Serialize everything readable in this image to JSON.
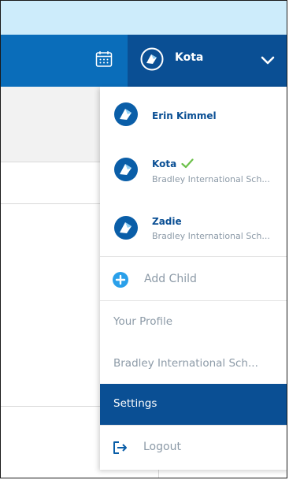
{
  "header": {
    "user_name": "Kota",
    "calendar_icon": "calendar-icon",
    "chevron_icon": "chevron-down-icon"
  },
  "dropdown": {
    "children": [
      {
        "name": "Erin Kimmel",
        "school": ""
      },
      {
        "name": "Kota",
        "school": "Bradley International Sch...",
        "selected": true
      },
      {
        "name": "Zadie",
        "school": "Bradley International Sch..."
      }
    ],
    "add_child_label": "Add Child",
    "menu": [
      {
        "label": "Your Profile"
      },
      {
        "label": "Bradley International Sch..."
      },
      {
        "label": "Settings",
        "active": true
      }
    ],
    "logout_label": "Logout"
  },
  "colors": {
    "header_blue": "#0a6dba",
    "header_dark": "#0a4f94",
    "top_light": "#cdecfb",
    "muted_text": "#8c9aa7",
    "check_green": "#6cc04a"
  }
}
